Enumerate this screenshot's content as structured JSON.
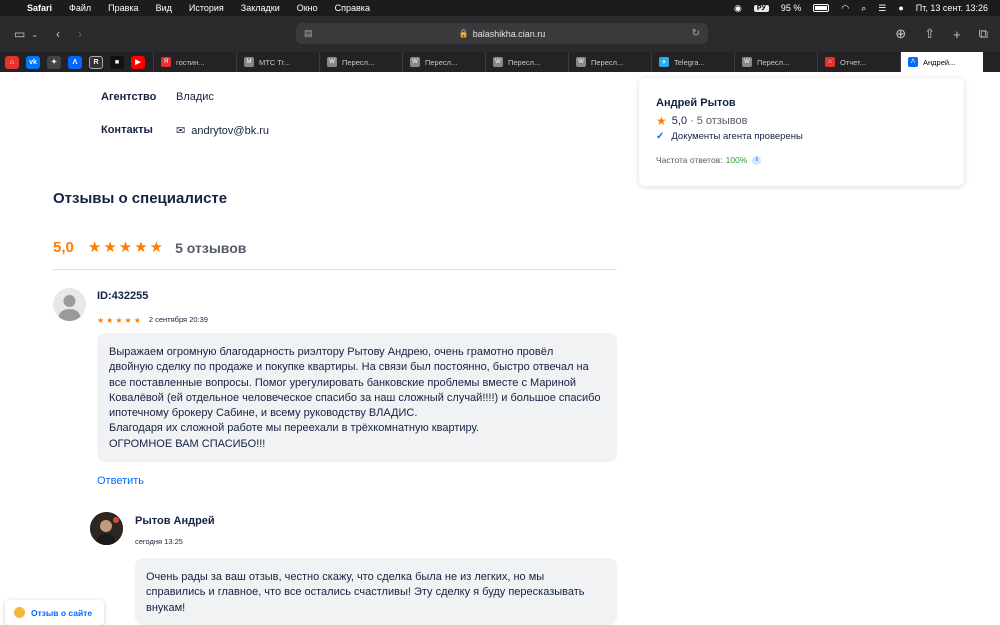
{
  "menubar": {
    "app": "Safari",
    "items": [
      "Файл",
      "Правка",
      "Вид",
      "История",
      "Закладки",
      "Окно",
      "Справка"
    ],
    "keyboard": "РУ",
    "battery": "95 %",
    "datetime": "Пт, 13 сент.  13:26"
  },
  "toolbar": {
    "url": "balashikha.cian.ru"
  },
  "tabs": [
    {
      "label": "гостин...",
      "fav_color": "#e5322d",
      "fav": "Я"
    },
    {
      "label": "МТС Тr...",
      "fav_color": "#888888",
      "fav": "M"
    },
    {
      "label": "Пересл...",
      "fav_color": "#888888",
      "fav": "W"
    },
    {
      "label": "Пересл...",
      "fav_color": "#888888",
      "fav": "W"
    },
    {
      "label": "Пересл...",
      "fav_color": "#888888",
      "fav": "W"
    },
    {
      "label": "Пересл...",
      "fav_color": "#888888",
      "fav": "W"
    },
    {
      "label": "Telegra...",
      "fav_color": "#2aabee",
      "fav": "✈"
    },
    {
      "label": "Пересл...",
      "fav_color": "#888888",
      "fav": "W"
    },
    {
      "label": "Отчет...",
      "fav_color": "#e5322d",
      "fav": "⌂"
    },
    {
      "label": "Андрей...",
      "fav_color": "#0468ff",
      "fav": "Λ"
    }
  ],
  "agent_info": {
    "agency_label": "Агентство",
    "agency_value": "Владис",
    "contacts_label": "Контакты",
    "email": "andrytov@bk.ru"
  },
  "reviews": {
    "title": "Отзывы о специалисте",
    "rating": "5,0",
    "count": "5 отзывов",
    "review": {
      "author": "ID:432255",
      "date": "2 сентября 20:39",
      "text": "Выражаем огромную благодарность риэлтору Рытову Андрею, очень грамотно провёл\nдвойную сделку по продаже и покупке квартиры. На связи был постоянно, быстро отвечал на\nвсе поставленные вопросы. Помог урегулировать банковские проблемы вместе с Мариной\nКовалёвой (ей отдельное человеческое спасибо за наш сложный случай!!!!) и большое спасибо\nипотечному брокеру Сабине, и всему руководству ВЛАДИС.\nБлагодаря их сложной работе мы переехали в трёхкомнатную квартиру.\nОГРОМНОЕ ВАМ СПАСИБО!!!",
      "reply_label": "Ответить"
    },
    "answer": {
      "author": "Рытов Андрей",
      "date": "сегодня 13:25",
      "text": "Очень рады за ваш отзыв, честно скажу, что сделка была не из легких, но мы\nсправились и главное, что все остались счастливы! Эту сделку я буду пересказывать\nвнукам!"
    }
  },
  "card": {
    "name": "Андрей Рытов",
    "rating": "5,0",
    "sep": "·",
    "reviews": "5 отзывов",
    "verified": "Документы агента проверены",
    "freq_label": "Частота ответов:",
    "freq_value": "100%"
  },
  "feedback": {
    "label": "Отзыв о сайте"
  },
  "colors": {
    "accent": "#0468ff",
    "star": "#ff7d00"
  }
}
